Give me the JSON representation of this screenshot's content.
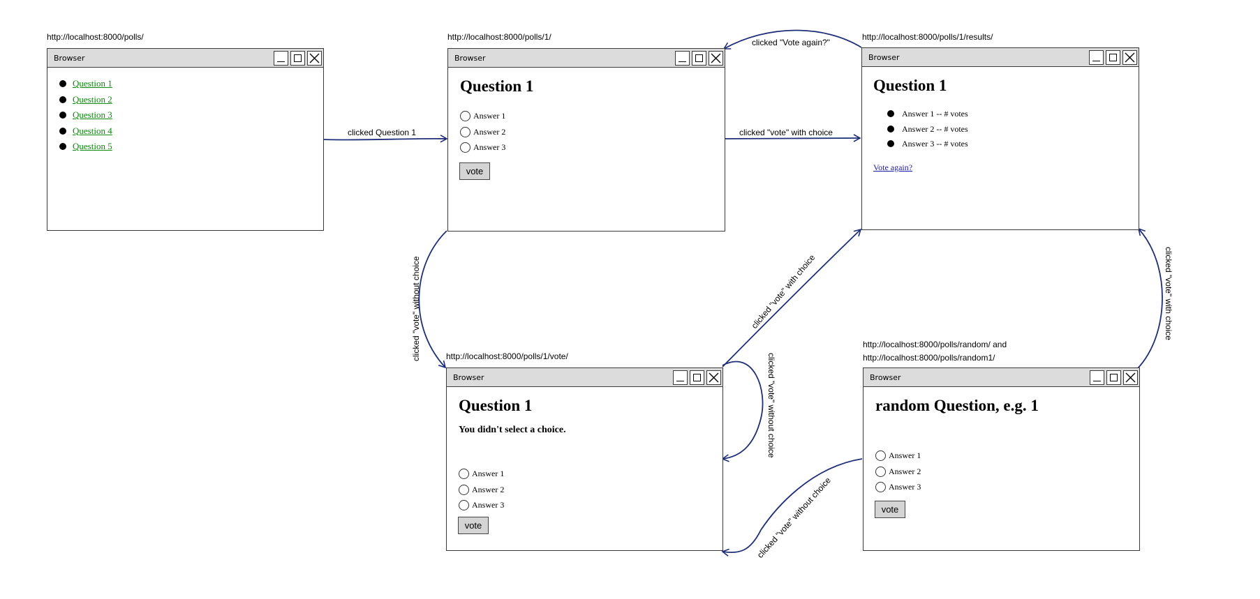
{
  "windows": {
    "polls": {
      "url": "http://localhost:8000/polls/",
      "title": "Browser",
      "questions": [
        "Question 1",
        "Question 2",
        "Question 3",
        "Question 4",
        "Question 5"
      ]
    },
    "detail": {
      "url": "http://localhost:8000/polls/1/",
      "title": "Browser",
      "heading": "Question 1",
      "answers": [
        "Answer 1",
        "Answer 2",
        "Answer 3"
      ],
      "button": "vote"
    },
    "results": {
      "url": "http://localhost:8000/polls/1/results/",
      "title": "Browser",
      "heading": "Question 1",
      "results": [
        "Answer 1 -- # votes",
        "Answer 2 -- # votes",
        "Answer 3 -- # votes"
      ],
      "link": "Vote again?"
    },
    "vote": {
      "url": "http://localhost:8000/polls/1/vote/",
      "title": "Browser",
      "heading": "Question 1",
      "error": "You didn't select a choice.",
      "answers": [
        "Answer 1",
        "Answer 2",
        "Answer 3"
      ],
      "button": "vote"
    },
    "random": {
      "url_line1": "http://localhost:8000/polls/random/    and",
      "url_line2": "http://localhost:8000/polls/random1/",
      "title": "Browser",
      "heading": "random Question, e.g. 1",
      "answers": [
        "Answer 1",
        "Answer 2",
        "Answer 3"
      ],
      "button": "vote"
    }
  },
  "edges": {
    "clicked_question1": "clicked Question 1",
    "vote_with_choice_top": "clicked \"vote\" with choice",
    "vote_again": "clicked \"Vote again?\"",
    "vote_without_choice_left": "clicked \"vote\" without choice",
    "vote_with_choice_diag": "clicked \"vote\" with choice",
    "vote_without_choice_self": "clicked \"vote\" without choice",
    "vote_with_choice_right": "clicked \"vote\" with choice",
    "vote_without_choice_random": "clicked \"vote\" without choice"
  },
  "colors": {
    "edge": "#1f2e78",
    "link_green": "#0b8a0b",
    "link_blue": "#1a1aa6",
    "titlebar": "#dcdcdc",
    "button": "#d4d4d4"
  }
}
